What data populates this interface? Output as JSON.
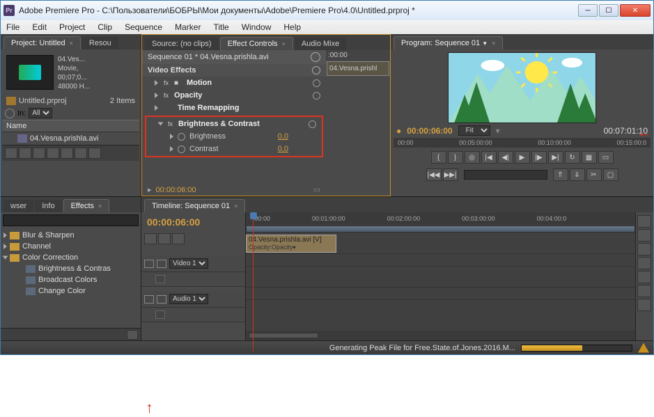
{
  "window": {
    "title": "Adobe Premiere Pro - C:\\Пользователи\\БОБРЫ\\Мои документы\\Adobe\\Premiere Pro\\4.0\\Untitled.prproj *"
  },
  "menu": [
    "File",
    "Edit",
    "Project",
    "Clip",
    "Sequence",
    "Marker",
    "Title",
    "Window",
    "Help"
  ],
  "project": {
    "tab": "Project: Untitled",
    "tab2": "Resou",
    "clip_name": "04.Ves...",
    "clip_meta1": "Movie, ",
    "clip_meta2": "00;07;0...",
    "clip_meta3": "48000 H...",
    "bin": "Untitled.prproj",
    "item_count": "2 Items",
    "search_placeholder": "In:",
    "search_scope": "All",
    "name_header": "Name",
    "item1": "04.Vesna.prishla.avi"
  },
  "source_tabs": [
    "Source: (no clips)",
    "Effect Controls",
    "Audio Mixe"
  ],
  "effect_controls": {
    "header": "Sequence 01 * 04.Vesna.prishla.avi",
    "video_effects": "Video Effects",
    "motion": "Motion",
    "opacity": "Opacity",
    "time_remap": "Time Remapping",
    "bc": "Brightness & Contrast",
    "brightness": "Brightness",
    "brightness_val": "0,0",
    "contrast": "Contrast",
    "contrast_val": "0,0",
    "foot_tc": "00:00:06:00",
    "tl_head": ":00:00",
    "tl_clip": "04.Vesna.prishl"
  },
  "program": {
    "tab": "Program: Sequence 01",
    "tc_current": "00:00:06:00",
    "fit": "Fit",
    "tc_duration": "00:07:01:10",
    "ruler": [
      "00:00",
      "00:05:00:00",
      "00:10:00:00",
      "00:15:00:0"
    ]
  },
  "effects_panel": {
    "tabs": [
      "wser",
      "Info",
      "Effects"
    ],
    "items": [
      "Blur & Sharpen",
      "Channel",
      "Color Correction"
    ],
    "children": [
      "Brightness & Contras",
      "Broadcast Colors",
      "Change Color"
    ]
  },
  "timeline": {
    "tab": "Timeline: Sequence 01",
    "tc": "00:00:06:00",
    "ruler": [
      ":00:00",
      "00:01:00:00",
      "00:02:00:00",
      "00:03:00:00",
      "00:04:00:0"
    ],
    "video_track": "Video 1",
    "audio_track": "Audio 1",
    "clip_label": "04.Vesna.prishla.avi [V]",
    "clip_opacity": "Opacity:Opacity"
  },
  "status": {
    "text": "Generating Peak File for Free.State.of.Jones.2016.M..."
  }
}
